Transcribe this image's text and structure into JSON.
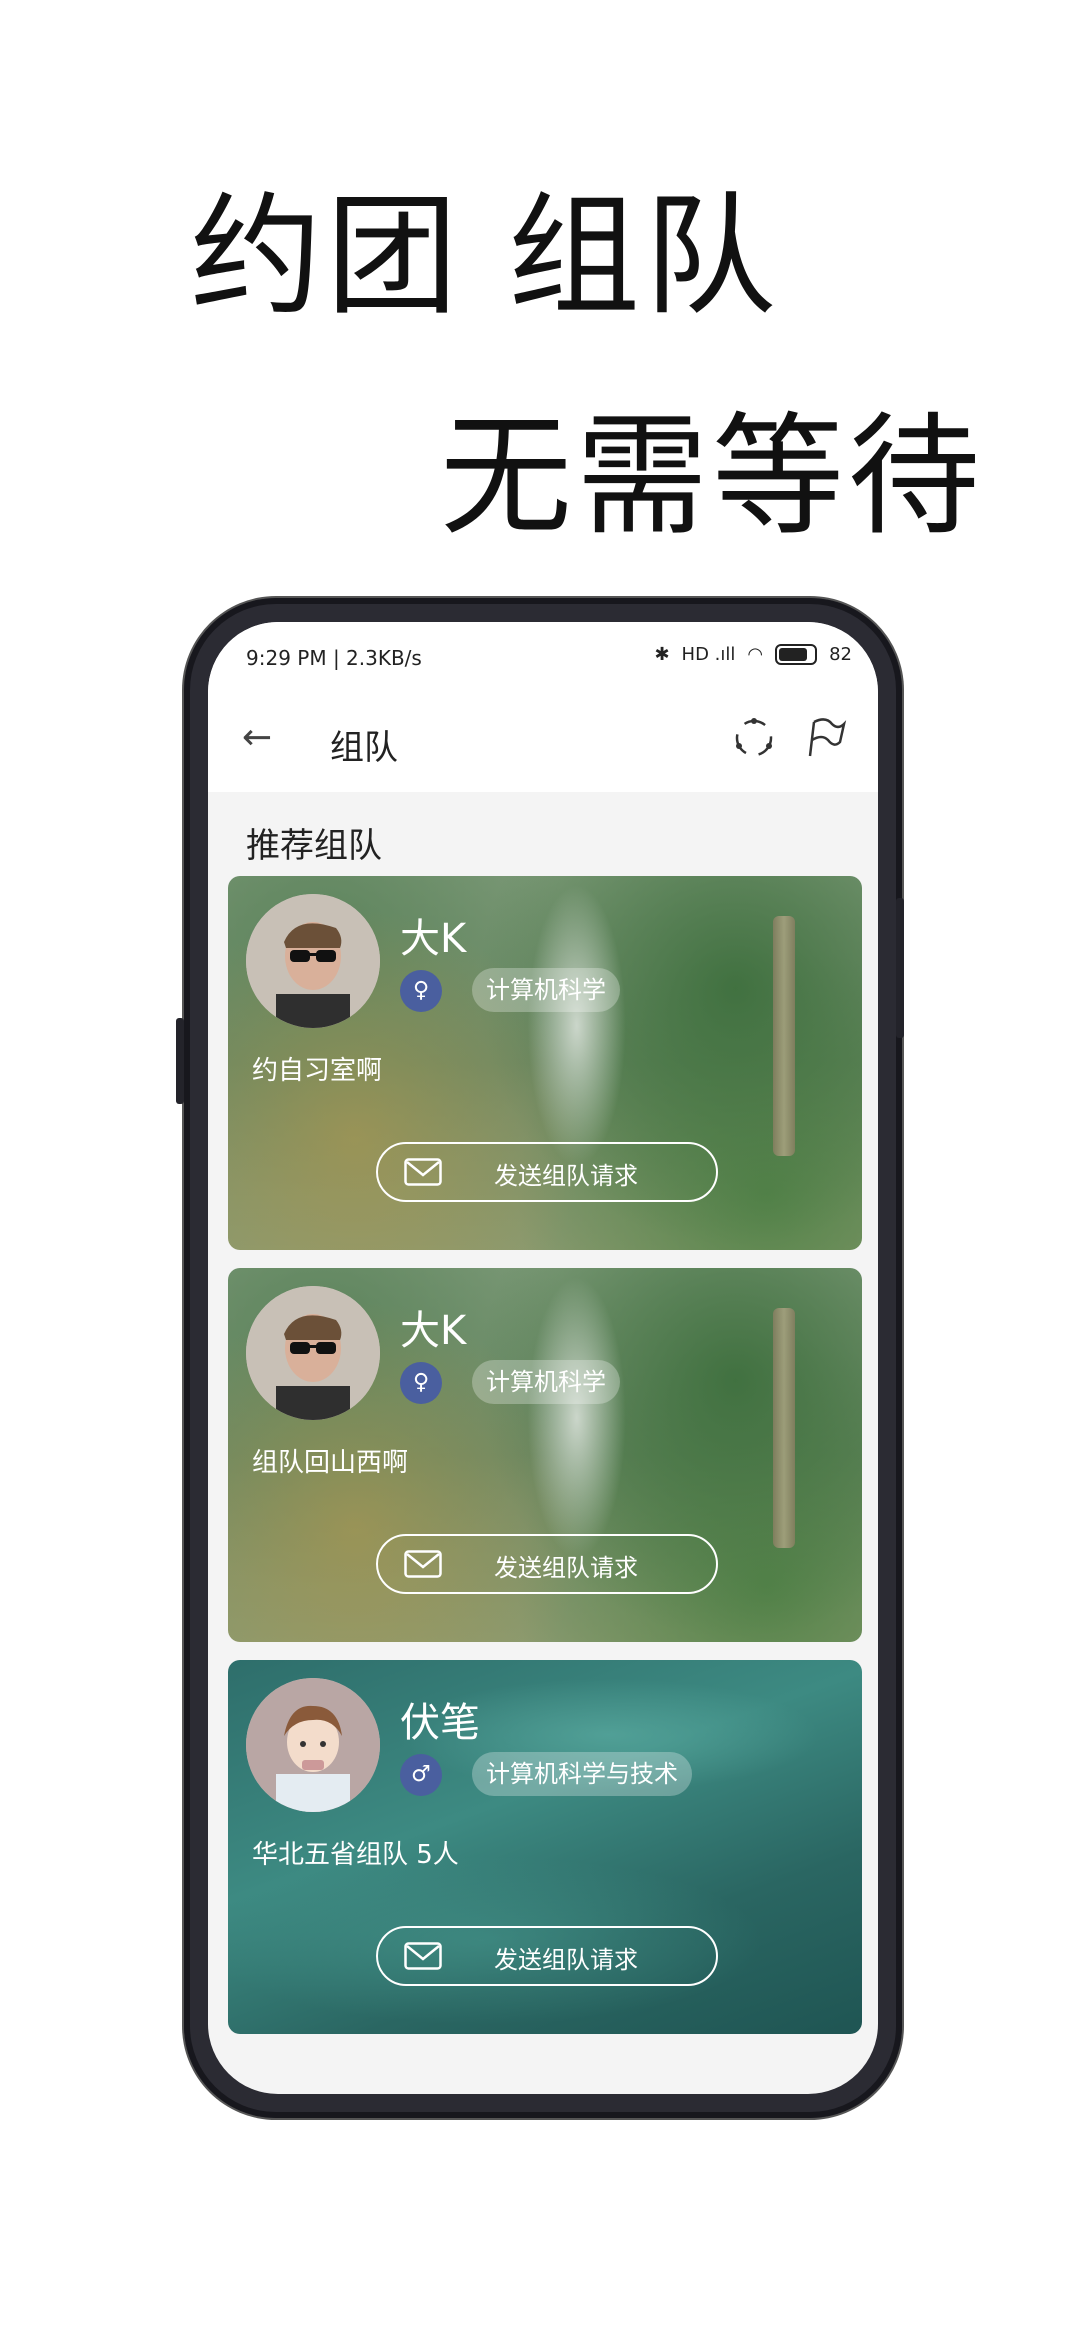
{
  "promo": {
    "line1": "约团  组队",
    "line2": "无需等待"
  },
  "status_bar": {
    "time": "9:29 PM | 2.3KB/s",
    "network": "HD .ıll",
    "battery": "82"
  },
  "app_bar": {
    "title": "组队"
  },
  "section_title": "推荐组队",
  "cards": [
    {
      "name": "大K",
      "gender": "♀",
      "major": "计算机科学",
      "desc": "约自习室啊",
      "button": "发送组队请求"
    },
    {
      "name": "大K",
      "gender": "♀",
      "major": "计算机科学",
      "desc": "组队回山西啊",
      "button": "发送组队请求"
    },
    {
      "name": "伏笔",
      "gender": "♂",
      "major": "计算机科学与技术",
      "desc": "华北五省组队  5人",
      "button": "发送组队请求"
    }
  ],
  "icons": {
    "back": "back-arrow-icon",
    "refresh": "refresh-icon",
    "flag": "flag-icon",
    "mail": "mail-icon",
    "alarm": "alarm-icon",
    "bluetooth": "bluetooth-icon",
    "wifi": "wifi-icon"
  },
  "colors": {
    "gender_badge": "#4a5f9f",
    "screen_bg": "#f4f4f4"
  }
}
